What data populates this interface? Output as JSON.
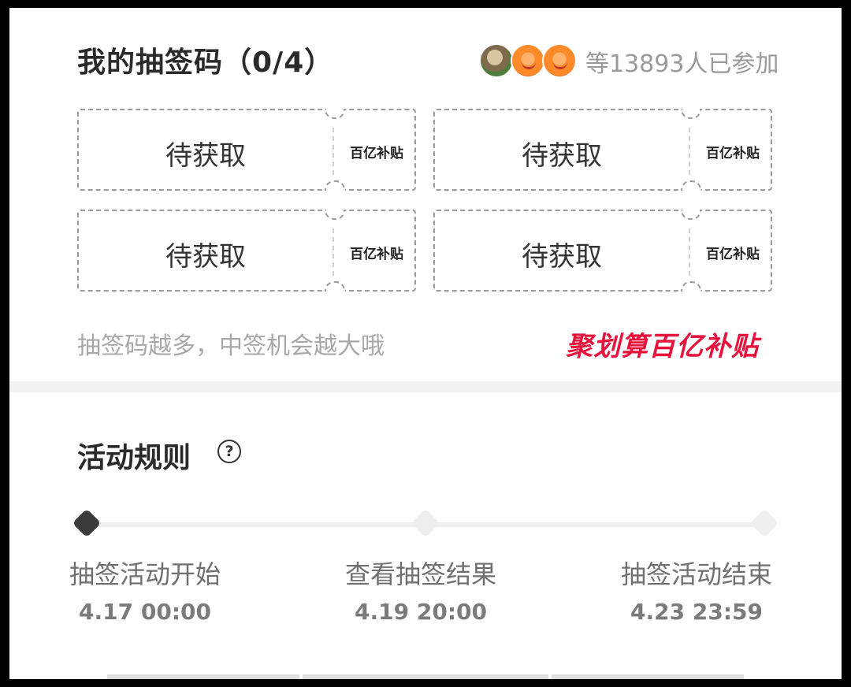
{
  "header": {
    "title": "我的抽签码（0/4）",
    "participants": "等13893人已参加",
    "avatars": [
      "avatar-squirrel",
      "avatar-orange-cat",
      "avatar-orange-cat"
    ]
  },
  "tickets": [
    {
      "status": "待获取",
      "brand": "百亿补贴"
    },
    {
      "status": "待获取",
      "brand": "百亿补贴"
    },
    {
      "status": "待获取",
      "brand": "百亿补贴"
    },
    {
      "status": "待获取",
      "brand": "百亿补贴"
    }
  ],
  "hint": "抽签码越多，中签机会越大哦",
  "logo": {
    "text": "聚划算百亿补贴",
    "color": "#e6143c"
  },
  "rules": {
    "title": "活动规则",
    "help_icon": "question-circle-icon",
    "steps": [
      {
        "label": "抽签活动开始",
        "time": "4.17 00:00",
        "active": true
      },
      {
        "label": "查看抽签结果",
        "time": "4.19 20:00",
        "active": false
      },
      {
        "label": "抽签活动结束",
        "time": "4.23 23:59",
        "active": false
      }
    ]
  },
  "colors": {
    "accent": "#e6143c",
    "active_node": "#3b3b3b",
    "inactive_node": "#efefef"
  }
}
